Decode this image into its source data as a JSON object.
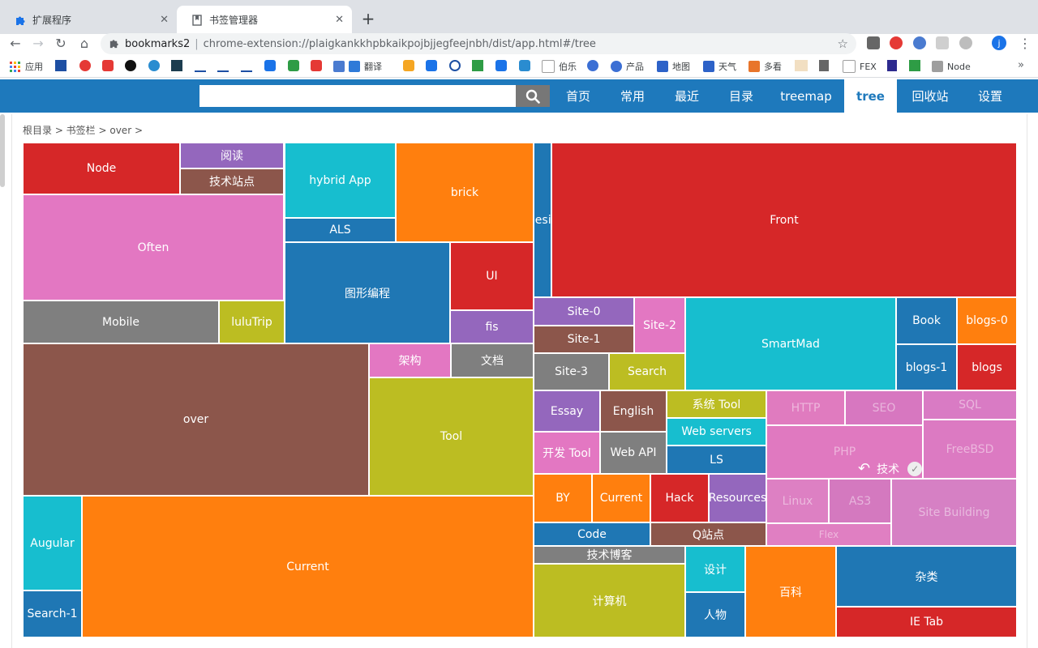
{
  "browser": {
    "tabs": [
      {
        "title": "扩展程序"
      },
      {
        "title": "书签管理器"
      }
    ],
    "new_tab": "+",
    "url_site": "bookmarks2",
    "url_separator": "|",
    "url_path": "chrome-extension://plaigkankkhpbkaikpojbjjegfeejnbh/dist/app.html#/tree",
    "profile_initial": "j"
  },
  "bookmarks_bar": {
    "apps_label": "应用",
    "items": [
      {
        "label": "翻译",
        "color": "#2f7ad8"
      },
      {
        "label": "伯乐",
        "color": "#9e9e9e"
      },
      {
        "label": "产品",
        "color": "#3b6fd4"
      },
      {
        "label": "地图",
        "color": "#2d62c8"
      },
      {
        "label": "天气",
        "color": "#2d62c8"
      },
      {
        "label": "多看",
        "color": "#e8752b"
      },
      {
        "label": "FEX",
        "color": "#9e9e9e"
      },
      {
        "label": "Node",
        "color": "#9e9e9e"
      }
    ],
    "more": "»"
  },
  "app": {
    "search_placeholder": "",
    "nav": [
      {
        "label": "首页"
      },
      {
        "label": "常用"
      },
      {
        "label": "最近"
      },
      {
        "label": "目录"
      },
      {
        "label": "treemap"
      },
      {
        "label": "tree",
        "active": true
      },
      {
        "label": "回收站"
      },
      {
        "label": "设置"
      }
    ],
    "breadcrumb": "根目录 > 书签栏 > over >"
  },
  "treemap": {
    "cells": [
      {
        "label": "Node",
        "color": "#d62728"
      },
      {
        "label": "阅读",
        "color": "#9467bd"
      },
      {
        "label": "技术站点",
        "color": "#8c564b"
      },
      {
        "label": "hybrid App",
        "color": "#17becf"
      },
      {
        "label": "ALS",
        "color": "#1f77b4"
      },
      {
        "label": "brick",
        "color": "#ff7f0e"
      },
      {
        "label": "Design",
        "color": "#1f77b4"
      },
      {
        "label": "Front",
        "color": "#d62728"
      },
      {
        "label": "Often",
        "color": "#e377c2"
      },
      {
        "label": "图形编程",
        "color": "#1f77b4"
      },
      {
        "label": "UI",
        "color": "#d62728"
      },
      {
        "label": "fis",
        "color": "#9467bd"
      },
      {
        "label": "Mobile",
        "color": "#7f7f7f"
      },
      {
        "label": "luluTrip",
        "color": "#bcbd22"
      },
      {
        "label": "Site-0",
        "color": "#9467bd"
      },
      {
        "label": "Site-2",
        "color": "#e377c2"
      },
      {
        "label": "Site-1",
        "color": "#8c564b"
      },
      {
        "label": "SmartMad",
        "color": "#17becf"
      },
      {
        "label": "Book",
        "color": "#1f77b4"
      },
      {
        "label": "blogs-0",
        "color": "#ff7f0e"
      },
      {
        "label": "over",
        "color": "#8c564b"
      },
      {
        "label": "架构",
        "color": "#e377c2"
      },
      {
        "label": "文档",
        "color": "#7f7f7f"
      },
      {
        "label": "Site-3",
        "color": "#7f7f7f"
      },
      {
        "label": "Search",
        "color": "#bcbd22"
      },
      {
        "label": "blogs-1",
        "color": "#1f77b4"
      },
      {
        "label": "blogs",
        "color": "#d62728"
      },
      {
        "label": "Tool",
        "color": "#bcbd22"
      },
      {
        "label": "Essay",
        "color": "#9467bd"
      },
      {
        "label": "English",
        "color": "#8c564b"
      },
      {
        "label": "系统 Tool",
        "color": "#bcbd22"
      },
      {
        "label": "Web servers",
        "color": "#17becf"
      },
      {
        "label": "开发 Tool",
        "color": "#e377c2"
      },
      {
        "label": "Web API",
        "color": "#7f7f7f"
      },
      {
        "label": "LS",
        "color": "#1f77b4"
      },
      {
        "label": "BY",
        "color": "#ff7f0e"
      },
      {
        "label": "Current",
        "color": "#ff7f0e"
      },
      {
        "label": "Hack",
        "color": "#d62728"
      },
      {
        "label": "Resources",
        "color": "#9467bd"
      },
      {
        "label": "Augular",
        "color": "#17becf"
      },
      {
        "label": "Current",
        "color": "#ff7f0e"
      },
      {
        "label": "Code",
        "color": "#1f77b4"
      },
      {
        "label": "Q站点",
        "color": "#8c564b"
      },
      {
        "label": "技术博客",
        "color": "#7f7f7f"
      },
      {
        "label": "计算机",
        "color": "#bcbd22"
      },
      {
        "label": "设计",
        "color": "#17becf"
      },
      {
        "label": "人物",
        "color": "#1f77b4"
      },
      {
        "label": "百科",
        "color": "#ff7f0e"
      },
      {
        "label": "杂类",
        "color": "#1f77b4"
      },
      {
        "label": "IE Tab",
        "color": "#d62728"
      },
      {
        "label": "Search-1",
        "color": "#1f77b4"
      }
    ],
    "overlay": {
      "label": "技术",
      "color": "#e377c2",
      "children": [
        "HTTP",
        "SEO",
        "SQL",
        "PHP",
        "FreeBSD",
        "Linux",
        "AS3",
        "Site Building",
        "Flex"
      ]
    }
  }
}
